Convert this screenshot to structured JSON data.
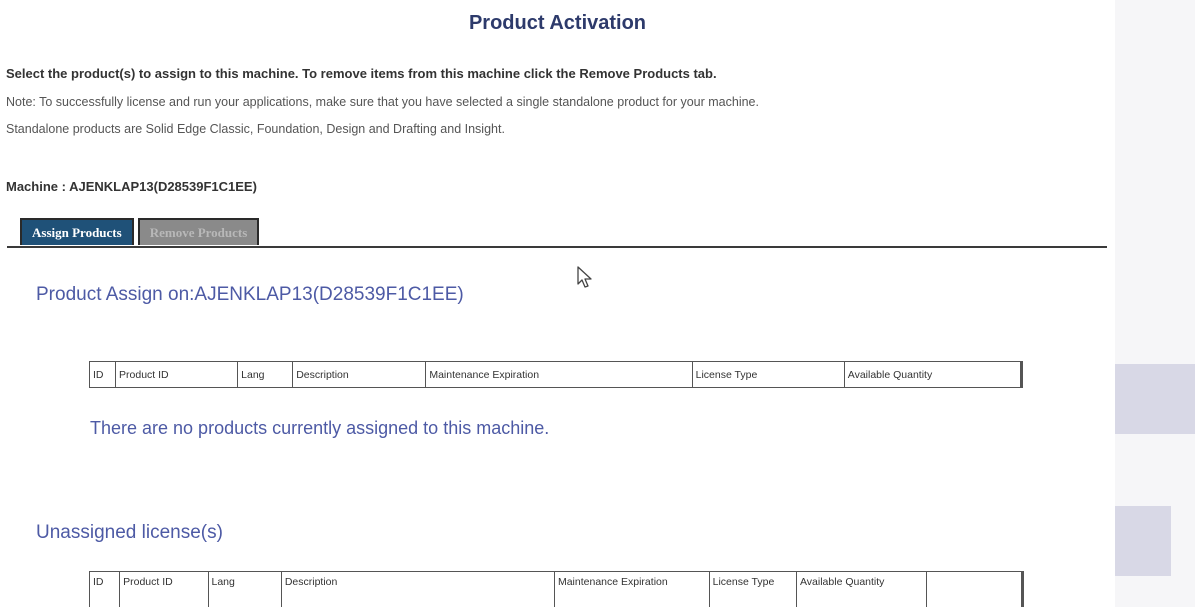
{
  "page": {
    "title": "Product Activation",
    "instruction": "Select the product(s) to assign to this machine. To remove items from this machine click the Remove Products tab.",
    "note_line1": "Note: To successfully license and run your applications, make sure that you have selected a single standalone product for your machine.",
    "note_line2": "Standalone products are Solid Edge Classic, Foundation, Design and Drafting and Insight.",
    "machine_label": "Machine : AJENKLAP13(D28539F1C1EE)"
  },
  "tabs": [
    {
      "label": "Assign Products",
      "active": true
    },
    {
      "label": "Remove Products",
      "active": false
    }
  ],
  "assigned": {
    "heading": "Product Assign on:AJENKLAP13(D28539F1C1EE)",
    "columns": [
      "ID",
      "Product ID",
      "Lang",
      "Description",
      "Maintenance Expiration",
      "License Type",
      "Available Quantity"
    ],
    "empty_message": "There are no products currently assigned to this machine."
  },
  "unassigned": {
    "heading": "Unassigned license(s)",
    "columns": [
      "ID",
      "Product ID",
      "Lang",
      "Description",
      "Maintenance Expiration",
      "License Type",
      "Available Quantity",
      ""
    ]
  },
  "colors": {
    "title": "#2d3a6b",
    "heading": "#4d5aa5",
    "active_tab": "#1f5178",
    "inactive_tab": "#8a8a8a"
  },
  "icons": {
    "cursor": "mouse-pointer-icon"
  }
}
